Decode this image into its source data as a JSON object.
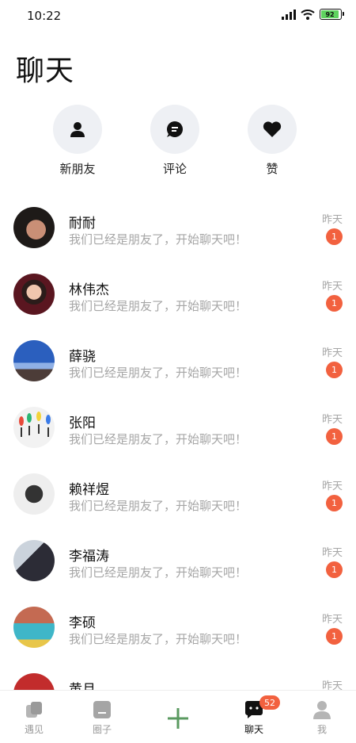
{
  "status_bar": {
    "time": "10:22",
    "battery": "92"
  },
  "page_title": "聊天",
  "shortcuts": [
    {
      "label": "新朋友",
      "icon": "person-icon"
    },
    {
      "label": "评论",
      "icon": "comment-bubble-icon"
    },
    {
      "label": "赞",
      "icon": "heart-icon"
    }
  ],
  "chats": [
    {
      "name": "耐耐",
      "preview": "我们已经是朋友了，开始聊天吧！",
      "time": "昨天",
      "unread": "1"
    },
    {
      "name": "林伟杰",
      "preview": "我们已经是朋友了，开始聊天吧！",
      "time": "昨天",
      "unread": "1"
    },
    {
      "name": "薛骁",
      "preview": "我们已经是朋友了，开始聊天吧！",
      "time": "昨天",
      "unread": "1"
    },
    {
      "name": "张阳",
      "preview": "我们已经是朋友了，开始聊天吧！",
      "time": "昨天",
      "unread": "1"
    },
    {
      "name": "赖祥煜",
      "preview": "我们已经是朋友了，开始聊天吧！",
      "time": "昨天",
      "unread": "1"
    },
    {
      "name": "李福涛",
      "preview": "我们已经是朋友了，开始聊天吧！",
      "time": "昨天",
      "unread": "1"
    },
    {
      "name": "李硕",
      "preview": "我们已经是朋友了，开始聊天吧！",
      "time": "昨天",
      "unread": "1"
    },
    {
      "name": "黄月",
      "preview": "",
      "time": "昨天",
      "unread": ""
    }
  ],
  "bottom_nav": {
    "items": [
      {
        "label": "遇见",
        "icon": "encounter-icon"
      },
      {
        "label": "圈子",
        "icon": "circle-icon"
      },
      {
        "label": "",
        "icon": "plus-icon"
      },
      {
        "label": "聊天",
        "icon": "chat-icon",
        "badge": "52"
      },
      {
        "label": "我",
        "icon": "profile-icon"
      }
    ]
  },
  "colors": {
    "badge": "#f2613f",
    "plus": "#5a9a60",
    "shortcut_bg": "#eef0f4"
  }
}
